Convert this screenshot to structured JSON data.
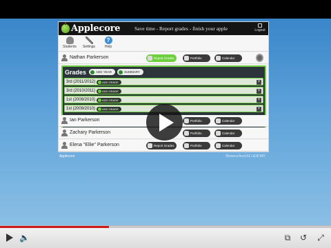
{
  "app": {
    "logo": "Applecore",
    "tagline": "Save time - Report grades - finish your apple",
    "logout_label": "Logout"
  },
  "toolbar": [
    {
      "label": "Students",
      "icon": "students-icon"
    },
    {
      "label": "Settings",
      "icon": "settings-icon"
    },
    {
      "label": "Help",
      "icon": "help-icon"
    }
  ],
  "students": [
    {
      "name": "Nathan Parkerson",
      "report_label": "Report Grades",
      "portfolio_label": "Portfolio",
      "calendar_label": "Calendar"
    },
    {
      "name": "Ian Parkerson",
      "portfolio_label": "Portfolio",
      "calendar_label": "Calendar"
    },
    {
      "name": "Zachary Parkerson",
      "portfolio_label": "Portfolio",
      "calendar_label": "Calendar"
    },
    {
      "name": "Elena \"Ellie\" Parkerson",
      "report_label": "Report Grades",
      "portfolio_label": "Portfolio",
      "calendar_label": "Calendar"
    }
  ],
  "grades": {
    "title": "Grades",
    "add_year": "ADD YEAR",
    "summary": "SUMMARY",
    "rows": [
      {
        "label": "3rd (2011/2012)",
        "action": "ADD GRADE"
      },
      {
        "label": "3rd (2010/2011)",
        "action": "ADD GRADE"
      },
      {
        "label": "1st (2009/2010)",
        "action": "ADD GRADE"
      },
      {
        "label": "1st (2009/2010)",
        "action": "ADD GRADE"
      }
    ]
  },
  "footer": {
    "left": "Applecore",
    "right": "HomeschoolACADEMY"
  },
  "player": {
    "progress_fraction": 0.33,
    "accent": "#cc1b1b"
  }
}
